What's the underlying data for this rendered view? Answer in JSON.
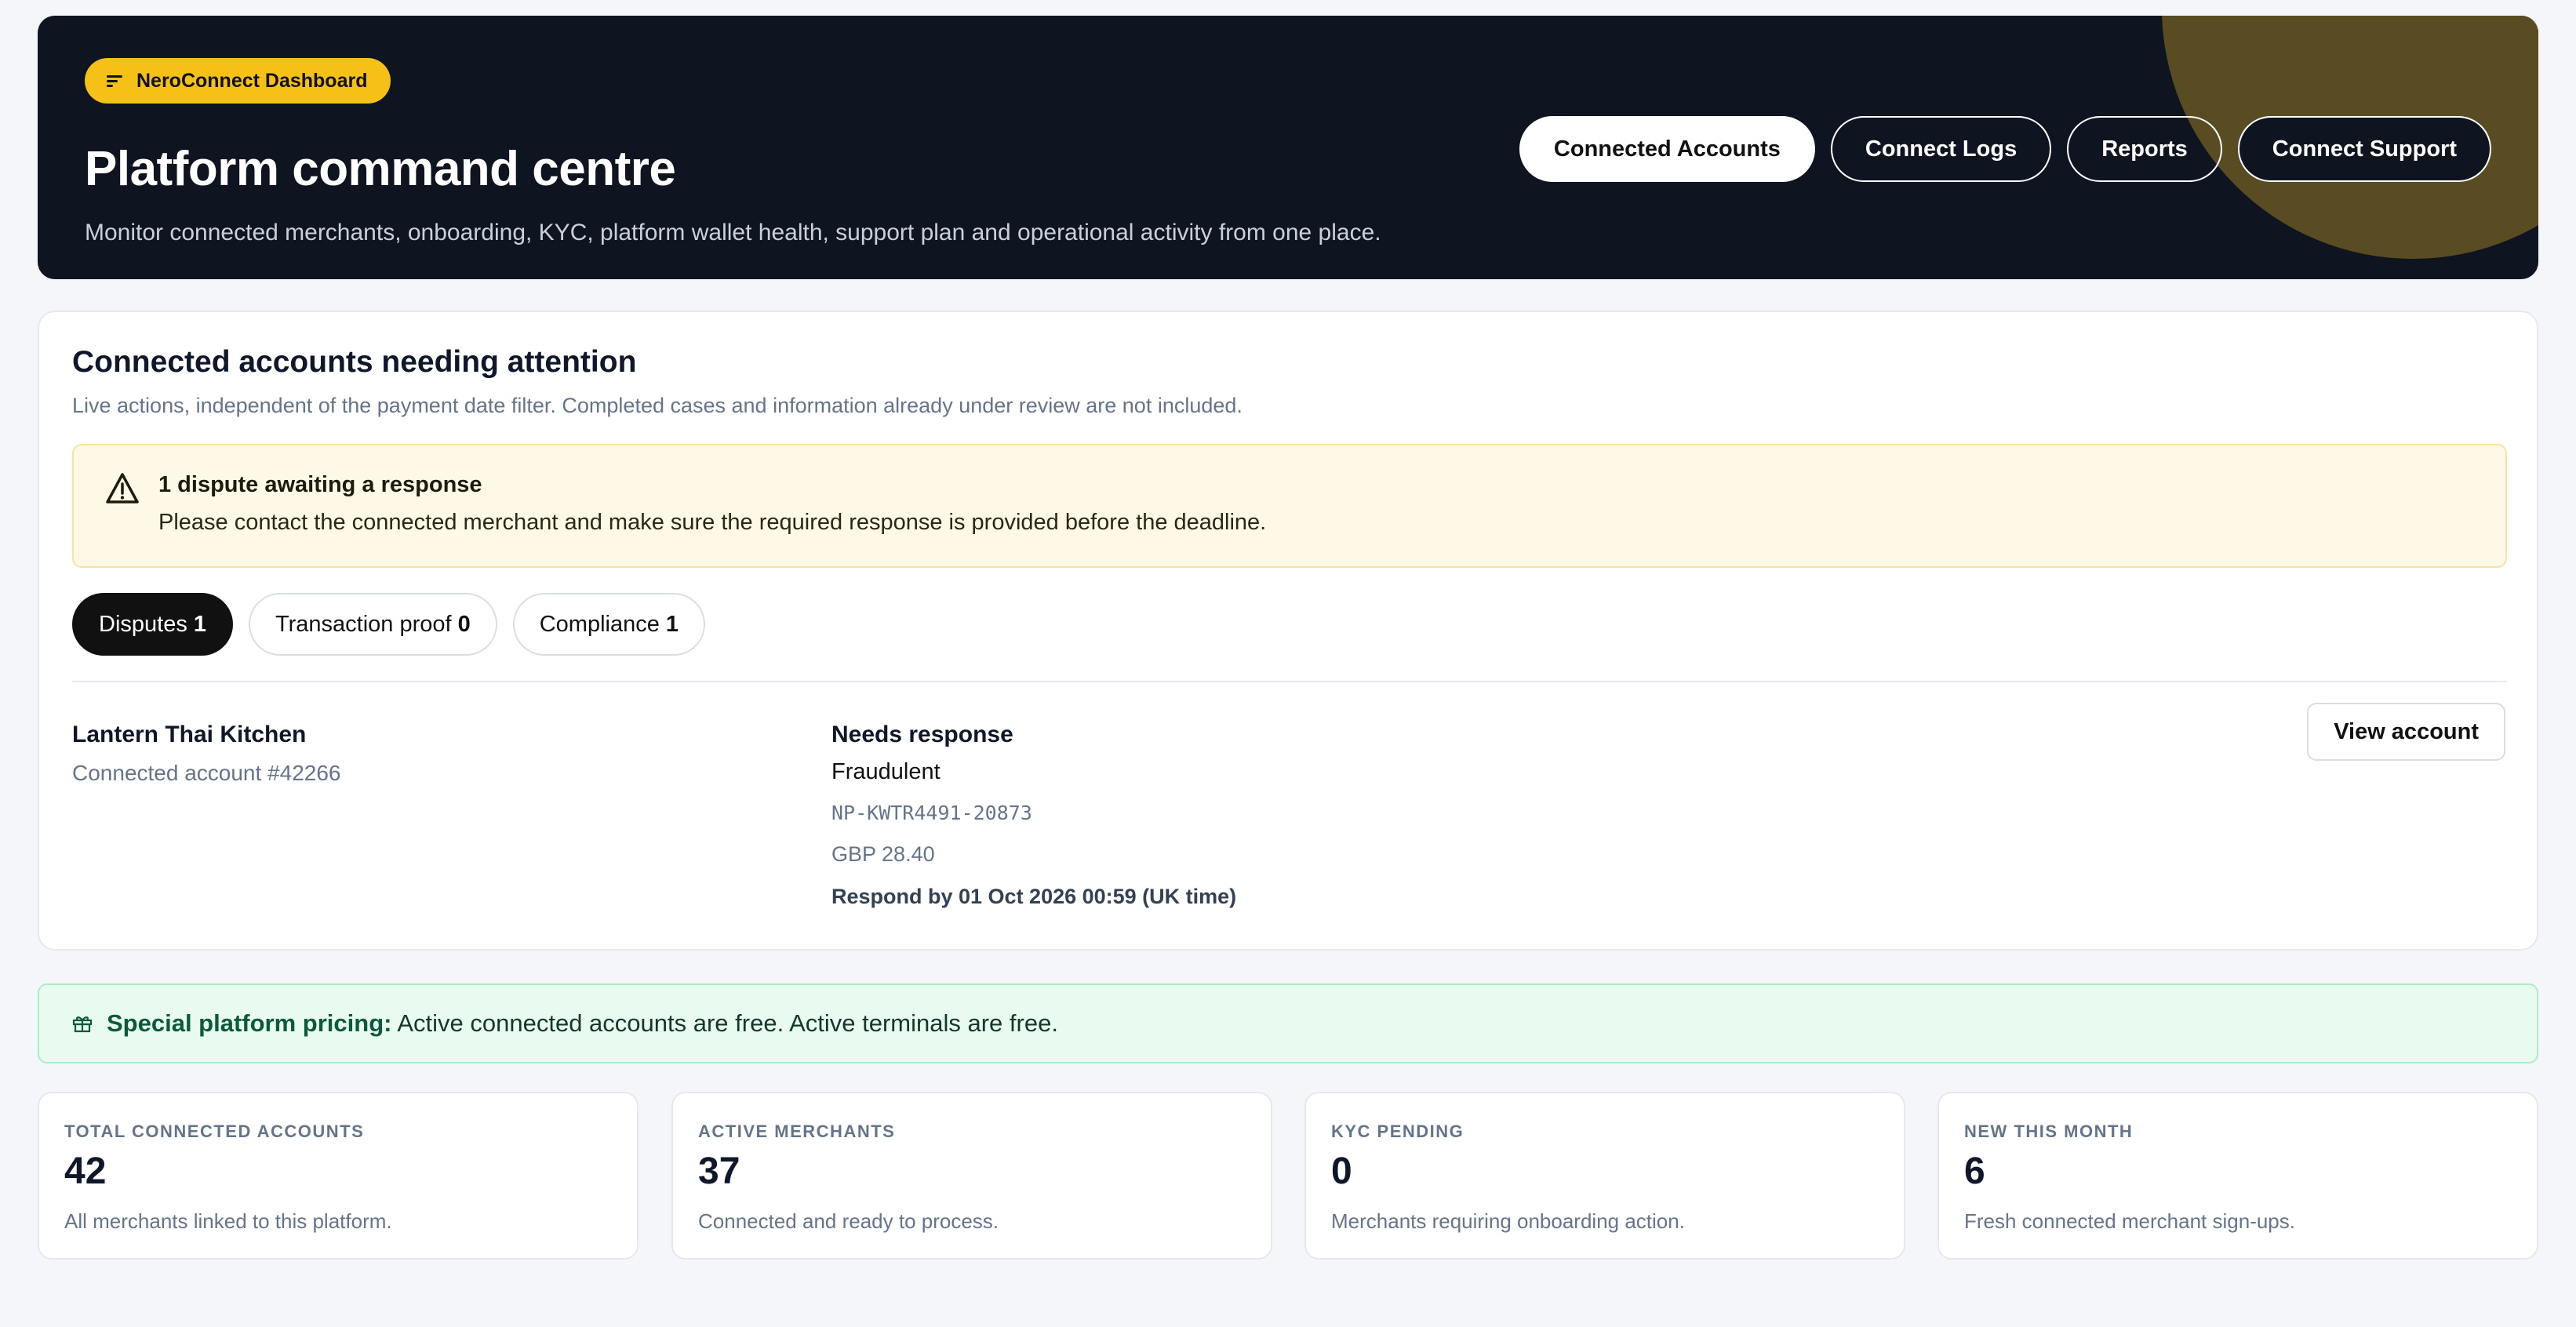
{
  "hero": {
    "badge": "NeroConnect Dashboard",
    "title": "Platform command centre",
    "subtitle": "Monitor connected merchants, onboarding, KYC, platform wallet health, support plan and operational activity from one place.",
    "actions": {
      "connected_accounts": "Connected Accounts",
      "connect_logs": "Connect Logs",
      "reports": "Reports",
      "connect_support": "Connect Support"
    }
  },
  "attention": {
    "title": "Connected accounts needing attention",
    "subtitle": "Live actions, independent of the payment date filter. Completed cases and information already under review are not included.",
    "alert": {
      "title": "1 dispute awaiting a response",
      "text": "Please contact the connected merchant and make sure the required response is provided before the deadline."
    },
    "tabs": [
      {
        "label": "Disputes",
        "count": "1",
        "active": true
      },
      {
        "label": "Transaction proof",
        "count": "0",
        "active": false
      },
      {
        "label": "Compliance",
        "count": "1",
        "active": false
      }
    ],
    "item": {
      "merchant": "Lantern Thai Kitchen",
      "account": "Connected account #42266",
      "status": "Needs response",
      "reason": "Fraudulent",
      "reference": "NP-KWTR4491-20873",
      "amount": "GBP 28.40",
      "deadline": "Respond by 01 Oct 2026 00:59 (UK time)",
      "button": "View account"
    }
  },
  "pricing": {
    "label": "Special platform pricing:",
    "text": "Active connected accounts are free. Active terminals are free."
  },
  "stats": [
    {
      "label": "TOTAL CONNECTED ACCOUNTS",
      "value": "42",
      "desc": "All merchants linked to this platform."
    },
    {
      "label": "ACTIVE MERCHANTS",
      "value": "37",
      "desc": "Connected and ready to process."
    },
    {
      "label": "KYC PENDING",
      "value": "0",
      "desc": "Merchants requiring onboarding action."
    },
    {
      "label": "NEW THIS MONTH",
      "value": "6",
      "desc": "Fresh connected merchant sign-ups."
    }
  ],
  "colors": {
    "hero_bg": "#0f1520",
    "badge": "#f5c116",
    "alert_bg": "#fef9e7",
    "pricing_bg": "#e9faf1"
  }
}
